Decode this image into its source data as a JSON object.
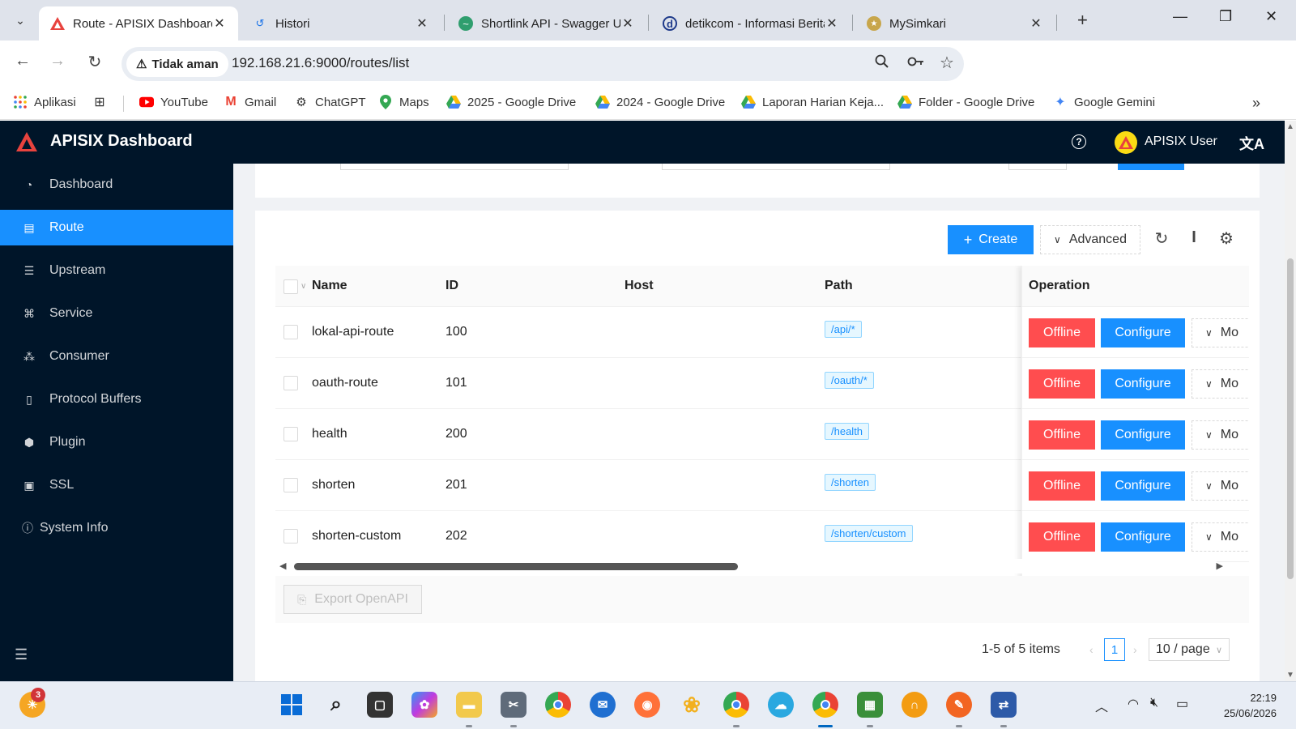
{
  "browser": {
    "tabs": [
      {
        "title": "Route - APISIX Dashboard",
        "active": true
      },
      {
        "title": "Histori",
        "active": false
      },
      {
        "title": "Shortlink API - Swagger UI",
        "active": false
      },
      {
        "title": "detikcom - Informasi Berita",
        "active": false
      },
      {
        "title": "MySimkari",
        "active": false
      }
    ],
    "security_label": "Tidak aman",
    "url": "192.168.21.6:9000/routes/list",
    "bookmarks": [
      {
        "label": "Aplikasi",
        "icon": "apps-grid-icon"
      },
      {
        "label": "",
        "icon": "tab-groups-icon"
      },
      {
        "label": "YouTube",
        "icon": "youtube-icon"
      },
      {
        "label": "Gmail",
        "icon": "gmail-icon"
      },
      {
        "label": "ChatGPT",
        "icon": "chatgpt-icon"
      },
      {
        "label": "Maps",
        "icon": "maps-icon"
      },
      {
        "label": "2025 - Google Drive",
        "icon": "google-drive-icon"
      },
      {
        "label": "2024 - Google Drive",
        "icon": "google-drive-icon"
      },
      {
        "label": "Laporan Harian Keja...",
        "icon": "google-drive-icon"
      },
      {
        "label": "Folder - Google Drive",
        "icon": "google-drive-icon"
      },
      {
        "label": "Google Gemini",
        "icon": "gemini-icon"
      }
    ],
    "colors": {
      "tabstrip": "#dfe3eb",
      "omnibox": "#e9edf3"
    }
  },
  "app": {
    "title": "APISIX Dashboard",
    "user": "APISIX User",
    "colors": {
      "header": "#001529",
      "primary": "#1890ff",
      "danger": "#ff4d4f"
    }
  },
  "sidebar": {
    "items": [
      {
        "label": "Dashboard",
        "icon": "dashboard-icon",
        "active": false
      },
      {
        "label": "Route",
        "icon": "route-icon",
        "active": true
      },
      {
        "label": "Upstream",
        "icon": "upstream-icon",
        "active": false
      },
      {
        "label": "Service",
        "icon": "service-icon",
        "active": false
      },
      {
        "label": "Consumer",
        "icon": "consumer-icon",
        "active": false
      },
      {
        "label": "Protocol Buffers",
        "icon": "protocol-buffers-icon",
        "active": false
      },
      {
        "label": "Plugin",
        "icon": "plugin-icon",
        "active": false
      },
      {
        "label": "SSL",
        "icon": "ssl-icon",
        "active": false
      },
      {
        "label": "System Info",
        "icon": "info-icon",
        "active": false
      }
    ]
  },
  "toolbar": {
    "create_label": "Create",
    "advanced_label": "Advanced"
  },
  "table": {
    "columns": {
      "name": "Name",
      "id": "ID",
      "host": "Host",
      "path": "Path",
      "operation": "Operation"
    },
    "rows": [
      {
        "name": "lokal-api-route",
        "id": "100",
        "host": "",
        "path": "/api/*"
      },
      {
        "name": "oauth-route",
        "id": "101",
        "host": "",
        "path": "/oauth/*"
      },
      {
        "name": "health",
        "id": "200",
        "host": "",
        "path": "/health"
      },
      {
        "name": "shorten",
        "id": "201",
        "host": "",
        "path": "/shorten"
      },
      {
        "name": "shorten-custom",
        "id": "202",
        "host": "",
        "path": "/shorten/custom"
      }
    ],
    "actions": {
      "offline": "Offline",
      "configure": "Configure",
      "more": "Mo"
    }
  },
  "footer": {
    "export_label": "Export OpenAPI"
  },
  "pagination": {
    "total_text": "1-5 of 5 items",
    "current_page": "1",
    "page_size": "10 / page"
  },
  "taskbar": {
    "notification_count": "3",
    "time": "22:19",
    "date": "25/06/2026"
  }
}
